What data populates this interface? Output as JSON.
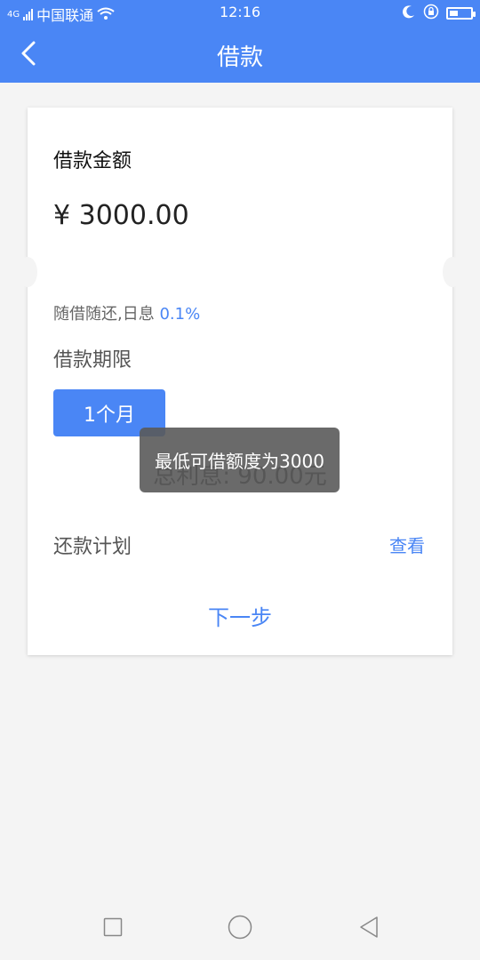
{
  "status_bar": {
    "network": "4G",
    "carrier": "中国联通",
    "time": "12:16",
    "battery_level": 0.35
  },
  "header": {
    "title": "借款"
  },
  "card": {
    "amount_label": "借款金额",
    "amount_value": "¥ 3000.00",
    "rate_prefix": "随借随还,日息",
    "rate_value": "0.1%",
    "term_label": "借款期限",
    "term_option": "1个月",
    "total_interest": "总利息: 90.00元",
    "plan_label": "还款计划",
    "plan_link": "查看",
    "next_button": "下一步"
  },
  "toast": {
    "message": "最低可借额度为3000"
  },
  "colors": {
    "primary": "#4a86f5",
    "background": "#f4f4f4"
  }
}
